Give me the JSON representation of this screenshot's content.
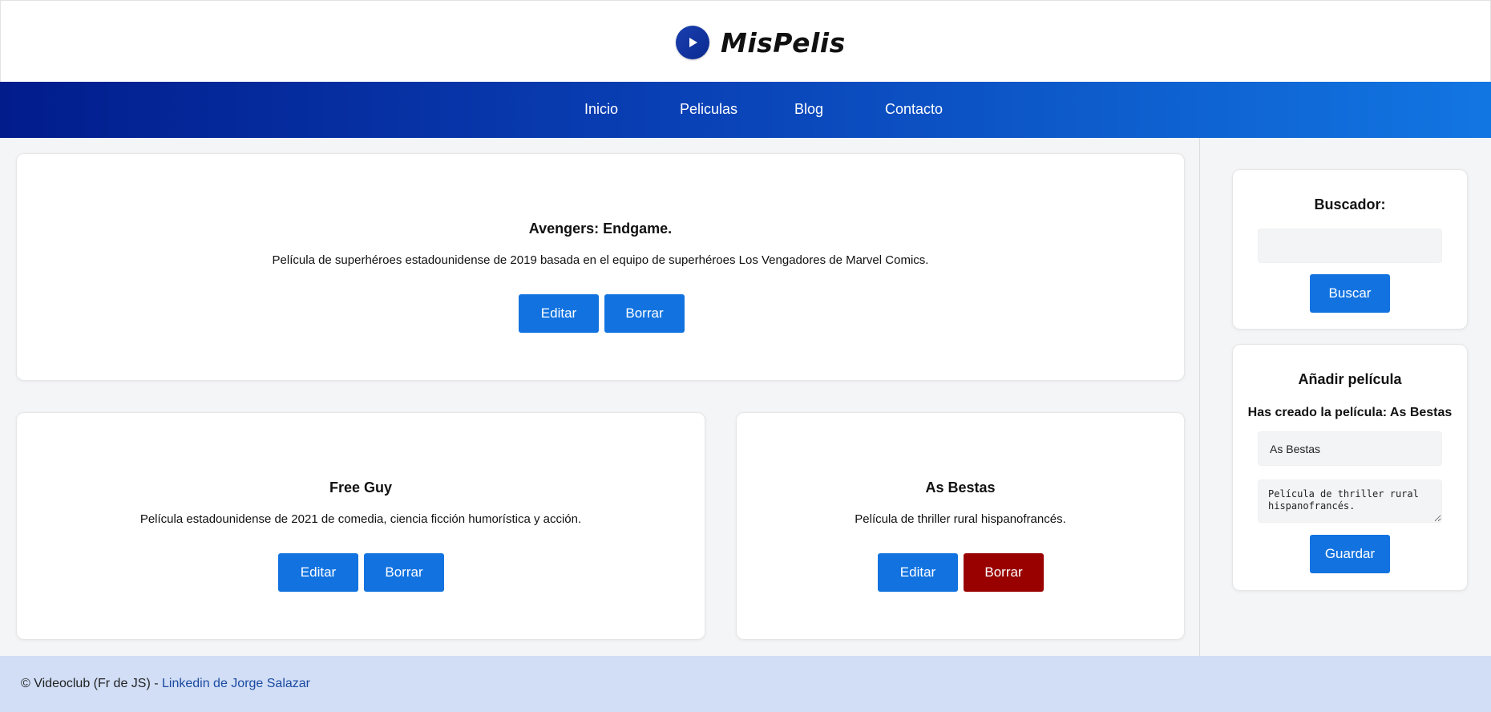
{
  "brand": {
    "name": "MisPelis",
    "icon": "play-icon"
  },
  "nav": {
    "items": [
      {
        "label": "Inicio"
      },
      {
        "label": "Peliculas"
      },
      {
        "label": "Blog"
      },
      {
        "label": "Contacto"
      }
    ]
  },
  "movies": [
    {
      "title": "Avengers: Endgame.",
      "description": "Película de superhéroes estadounidense de 2019 basada en el equipo de superhéroes Los Vengadores de Marvel Comics.",
      "edit_label": "Editar",
      "delete_label": "Borrar"
    },
    {
      "title": "Free Guy",
      "description": "Película estadounidense de 2021 de comedia, ciencia ficción humorística y acción.",
      "edit_label": "Editar",
      "delete_label": "Borrar"
    },
    {
      "title": "As Bestas",
      "description": "Película de thriller rural hispanofrancés.",
      "edit_label": "Editar",
      "delete_label": "Borrar"
    }
  ],
  "search": {
    "title": "Buscador:",
    "value": "",
    "button_label": "Buscar"
  },
  "add_movie": {
    "title": "Añadir película",
    "status": "Has creado la película: As Bestas",
    "title_value": "As Bestas",
    "description_value": "Película de thriller rural hispanofrancés.",
    "button_label": "Guardar"
  },
  "footer": {
    "text": "© Videoclub (Fr de JS) - ",
    "link_label": "Linkedin de Jorge Salazar"
  },
  "colors": {
    "primary": "#1273e0",
    "danger": "#990000",
    "nav_gradient_start": "#021c8c",
    "nav_gradient_end": "#1276e2",
    "footer_bg": "#d1def6"
  }
}
